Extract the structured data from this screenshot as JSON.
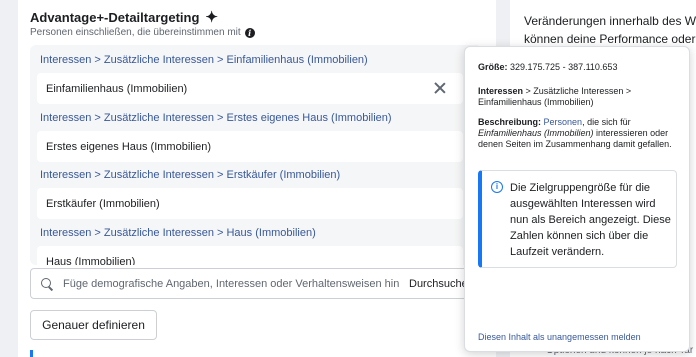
{
  "targeting": {
    "title": "Advantage+-Detailtargeting",
    "subtitle": "Personen einschließen, die übereinstimmen mit",
    "info_icon": "i",
    "items": [
      {
        "breadcrumb": "Interessen > Zusätzliche Interessen > Einfamilienhaus (Immobilien)",
        "label": "Einfamilienhaus (Immobilien)"
      },
      {
        "breadcrumb": "Interessen > Zusätzliche Interessen > Erstes eigenes Haus (Immobilien)",
        "label": "Erstes eigenes Haus (Immobilien)"
      },
      {
        "breadcrumb": "Interessen > Zusätzliche Interessen > Erstkäufer (Immobilien)",
        "label": "Erstkäufer (Immobilien)"
      },
      {
        "breadcrumb": "Interessen > Zusätzliche Interessen > Haus (Immobilien)",
        "label": "Haus (Immobilien)"
      }
    ],
    "search": {
      "placeholder": "Füge demografische Angaben, Interessen oder Verhaltensweisen hin",
      "browse_label": "Durchsuchen"
    },
    "define_button": "Genauer definieren"
  },
  "right_panel": {
    "line1": "Veränderungen innerhalb des Werbe",
    "line2": "können deine Performance oder de",
    "bottom": "Optionen und können je nach Tar"
  },
  "popover": {
    "size_label": "Größe:",
    "size_value": " 329.175.725 - 387.110.653",
    "path_label": "Interessen",
    "path_rest": " > Zusätzliche Interessen > Einfamilienhaus (Immobilien)",
    "desc_label": "Beschreibung:",
    "desc_link": "Personen",
    "desc_mid": ", die sich für ",
    "desc_italic": "Einfamilienhaus (Immobilien)",
    "desc_end": " interessieren oder denen Seiten im Zusammenhang damit gefallen.",
    "notice_icon": "i",
    "notice_text": "Die Zielgruppengröße für die ausgewählten Interessen wird nun als Bereich angezeigt. Diese Zahlen können sich über die Laufzeit verändern.",
    "report_link": "Diesen Inhalt als unangemessen melden"
  },
  "colors": {
    "accent": "#1877f2",
    "link": "#385898"
  }
}
